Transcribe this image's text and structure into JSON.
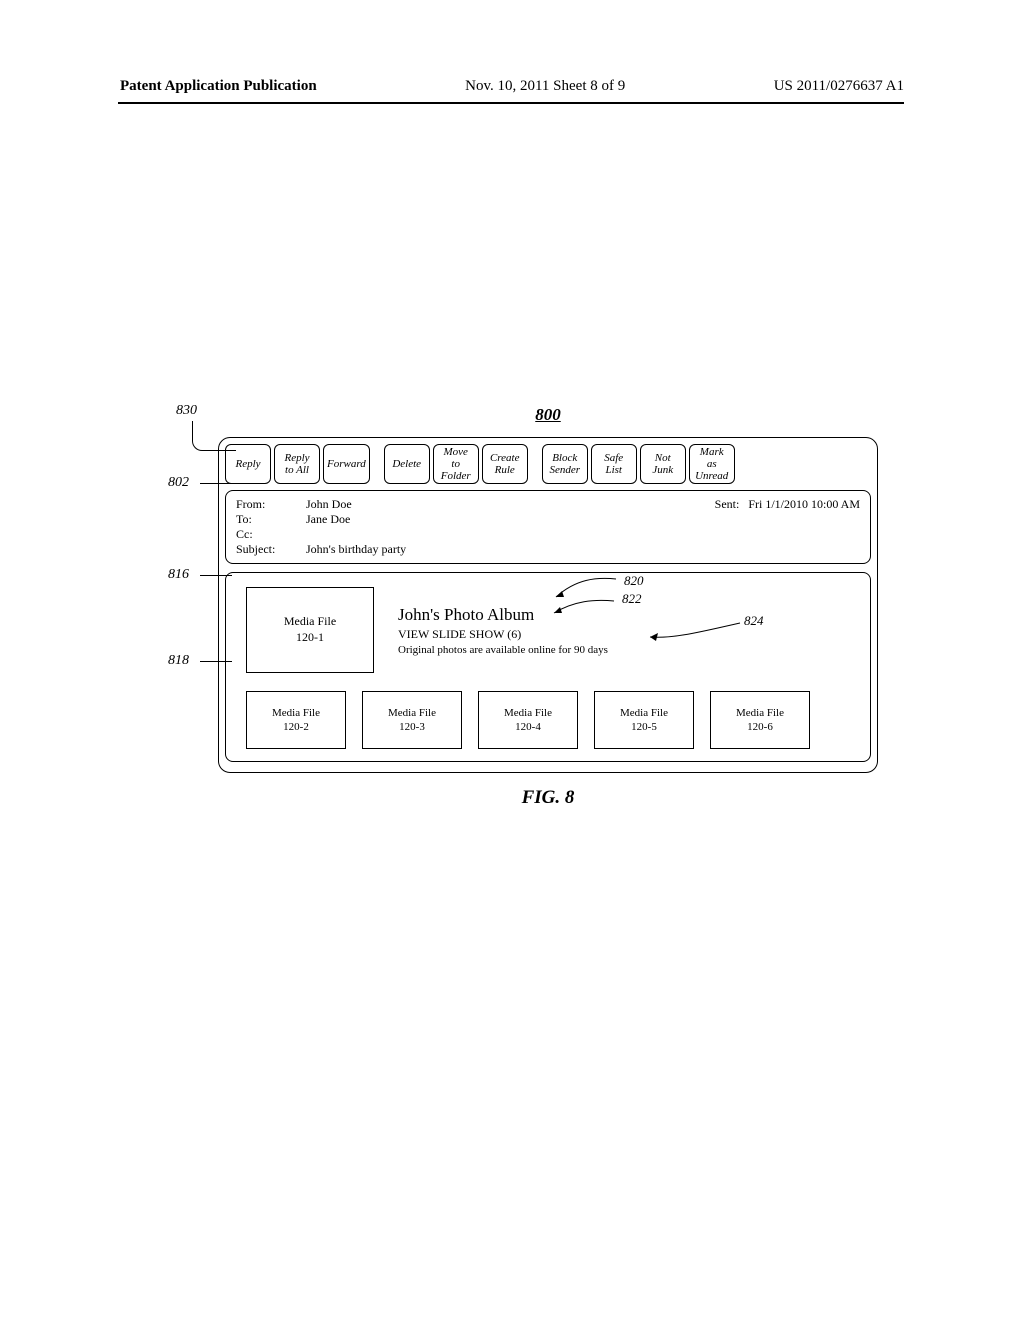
{
  "page_header": {
    "left": "Patent Application Publication",
    "center": "Nov. 10, 2011  Sheet 8 of 9",
    "right": "US 2011/0276637 A1"
  },
  "figure": {
    "ref_main": "800",
    "ref_toolbar_leader": "830",
    "ref_toolbar": "802",
    "ref_header": "816",
    "ref_body": "818",
    "ref_album_title": "820",
    "ref_album_link": "822",
    "ref_album_note": "824",
    "caption": "FIG. 8"
  },
  "toolbar": {
    "group1": [
      {
        "label": "Reply"
      },
      {
        "label": "Reply\nto All"
      },
      {
        "label": "Forward"
      }
    ],
    "group2": [
      {
        "label": "Delete"
      },
      {
        "label": "Move\nto\nFolder"
      },
      {
        "label": "Create\nRule"
      }
    ],
    "group3": [
      {
        "label": "Block\nSender"
      },
      {
        "label": "Safe\nList"
      },
      {
        "label": "Not\nJunk"
      },
      {
        "label": "Mark\nas\nUnread"
      }
    ]
  },
  "header_panel": {
    "from_label": "From:",
    "from_value": "John Doe",
    "to_label": "To:",
    "to_value": "Jane Doe",
    "cc_label": "Cc:",
    "cc_value": "",
    "subject_label": "Subject:",
    "subject_value": "John's birthday party",
    "sent_label": "Sent:",
    "sent_value": "Fri 1/1/2010 10:00 AM"
  },
  "body_panel": {
    "media_big": "Media File\n120-1",
    "album_title": "John's Photo Album",
    "album_link": "VIEW SLIDE SHOW (6)",
    "album_note": "Original photos are available online for 90 days",
    "thumbs": [
      "Media File\n120-2",
      "Media File\n120-3",
      "Media File\n120-4",
      "Media File\n120-5",
      "Media File\n120-6"
    ]
  }
}
